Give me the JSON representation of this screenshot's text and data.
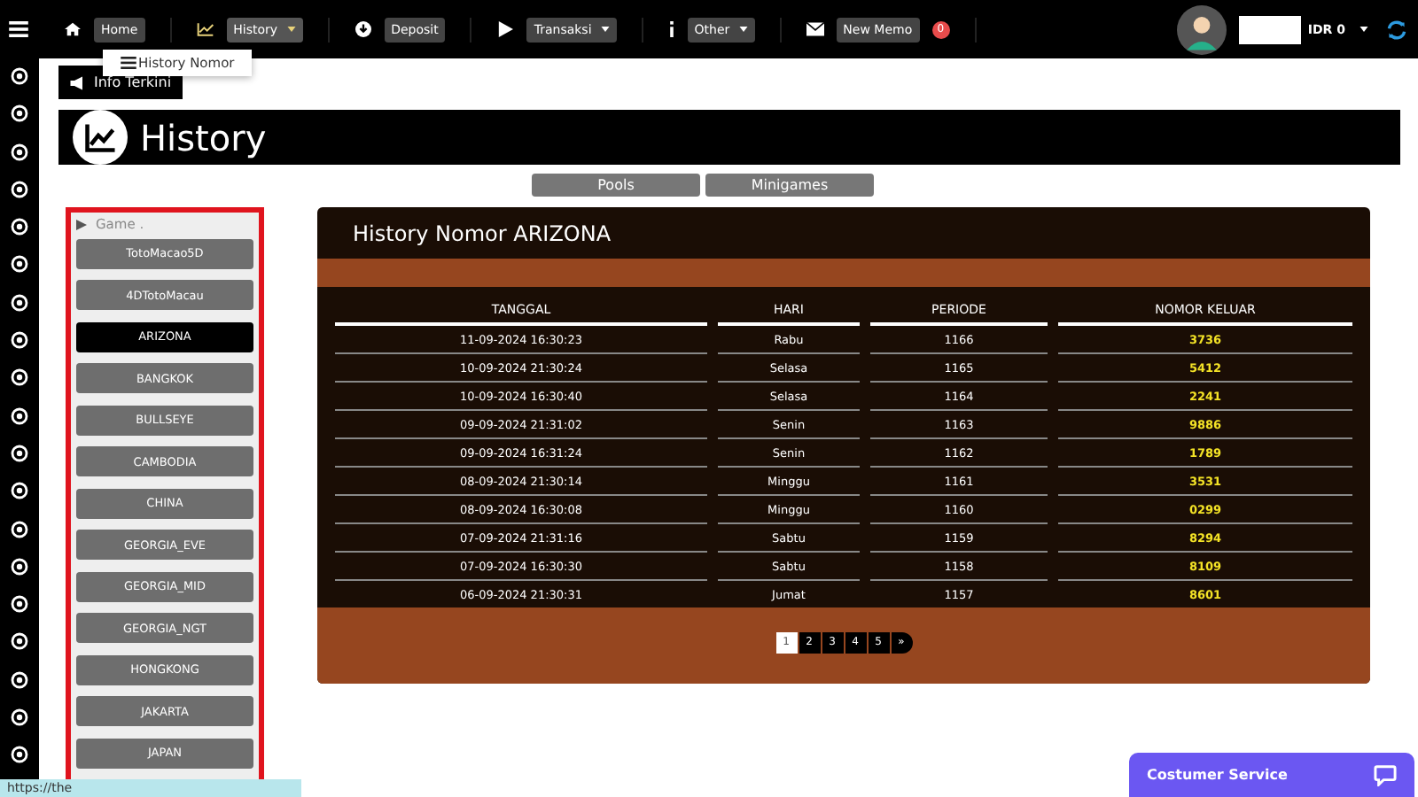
{
  "nav": [
    {
      "label": "Home",
      "caret": false,
      "selected": false
    },
    {
      "label": "History",
      "caret": true,
      "selected": true
    },
    {
      "label": "Deposit",
      "caret": false,
      "selected": false
    },
    {
      "label": "Transaksi",
      "caret": true,
      "selected": false
    },
    {
      "label": "Other",
      "caret": true,
      "selected": false
    },
    {
      "label": "New Memo",
      "caret": false,
      "selected": false,
      "badge": "0"
    }
  ],
  "dropdown": {
    "items": [
      "History Nomor"
    ]
  },
  "account": {
    "balance": "IDR 0"
  },
  "info_button": "Info Terkini",
  "page_title": "History",
  "tabs": [
    {
      "label": "Pools",
      "selected": false
    },
    {
      "label": "Minigames",
      "selected": false
    }
  ],
  "games": {
    "heading": "Game .",
    "items": [
      {
        "label": "TotoMacao5D",
        "selected": false
      },
      {
        "label": "4DTotoMacau",
        "selected": false
      },
      {
        "label": "ARIZONA",
        "selected": true
      },
      {
        "label": "BANGKOK",
        "selected": false
      },
      {
        "label": "BULLSEYE",
        "selected": false
      },
      {
        "label": "CAMBODIA",
        "selected": false
      },
      {
        "label": "CHINA",
        "selected": false
      },
      {
        "label": "GEORGIA_EVE",
        "selected": false
      },
      {
        "label": "GEORGIA_MID",
        "selected": false
      },
      {
        "label": "GEORGIA_NGT",
        "selected": false
      },
      {
        "label": "HONGKONG",
        "selected": false
      },
      {
        "label": "JAKARTA",
        "selected": false
      },
      {
        "label": "JAPAN",
        "selected": false
      }
    ]
  },
  "table": {
    "title": "History Nomor ARIZONA",
    "columns": [
      "TANGGAL",
      "HARI",
      "PERIODE",
      "NOMOR KELUAR"
    ],
    "rows": [
      [
        "11-09-2024 16:30:23",
        "Rabu",
        "1166",
        "3736"
      ],
      [
        "10-09-2024 21:30:24",
        "Selasa",
        "1165",
        "5412"
      ],
      [
        "10-09-2024 16:30:40",
        "Selasa",
        "1164",
        "2241"
      ],
      [
        "09-09-2024 21:31:02",
        "Senin",
        "1163",
        "9886"
      ],
      [
        "09-09-2024 16:31:24",
        "Senin",
        "1162",
        "1789"
      ],
      [
        "08-09-2024 21:30:14",
        "Minggu",
        "1161",
        "3531"
      ],
      [
        "08-09-2024 16:30:08",
        "Minggu",
        "1160",
        "0299"
      ],
      [
        "07-09-2024 21:31:16",
        "Sabtu",
        "1159",
        "8294"
      ],
      [
        "07-09-2024 16:30:30",
        "Sabtu",
        "1158",
        "8109"
      ],
      [
        "06-09-2024 21:30:31",
        "Jumat",
        "1157",
        "8601"
      ]
    ],
    "pages": [
      {
        "label": "1",
        "selected": true
      },
      {
        "label": "2",
        "selected": false
      },
      {
        "label": "3",
        "selected": false
      },
      {
        "label": "4",
        "selected": false
      },
      {
        "label": "5",
        "selected": false
      },
      {
        "label": "»",
        "selected": false
      }
    ]
  },
  "chat_button": "Costumer Service",
  "status_url": "https://the"
}
